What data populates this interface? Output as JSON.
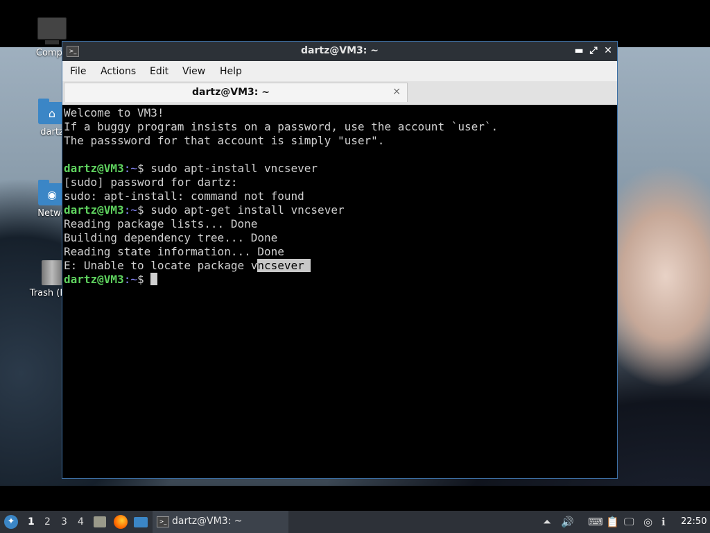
{
  "desktop": {
    "icons": [
      {
        "label": "Compu",
        "icon": "computer-icon"
      },
      {
        "label": "dartz",
        "icon": "home-folder-icon"
      },
      {
        "label": "Netwo",
        "icon": "network-folder-icon"
      },
      {
        "label": "Trash (Em",
        "icon": "trash-icon"
      }
    ]
  },
  "window": {
    "title": "dartz@VM3: ~",
    "controls": {
      "minimize": "▬",
      "maximize": "⤢",
      "close": "✕"
    }
  },
  "menubar": {
    "items": [
      "File",
      "Actions",
      "Edit",
      "View",
      "Help"
    ]
  },
  "tab": {
    "label": "dartz@VM3: ~",
    "close": "×"
  },
  "terminal": {
    "prompt_user": "dartz@VM3",
    "prompt_path": ":~",
    "prompt_symbol": "$ ",
    "motd": [
      "Welcome to VM3!",
      "If a buggy program insists on a password, use the account `user`.",
      "The passsword for that account is simply \"user\"."
    ],
    "cmd1": "sudo apt-install vncsever",
    "out1": [
      "[sudo] password for dartz:",
      "sudo: apt-install: command not found"
    ],
    "cmd2": "sudo apt-get install vncsever",
    "out2": [
      "Reading package lists... Done",
      "Building dependency tree... Done",
      "Reading state information... Done"
    ],
    "error_prefix": "E: Unable to locate package v",
    "error_selected": "ncsever "
  },
  "taskbar": {
    "workspaces": [
      "1",
      "2",
      "3",
      "4"
    ],
    "active_workspace": "1",
    "task_label": "dartz@VM3: ~",
    "clock": "22:50"
  },
  "colors": {
    "prompt_user": "#5fd35f",
    "prompt_path": "#8a8aff",
    "window_border": "#3d6fa3",
    "taskbar_bg": "#2d3138"
  }
}
